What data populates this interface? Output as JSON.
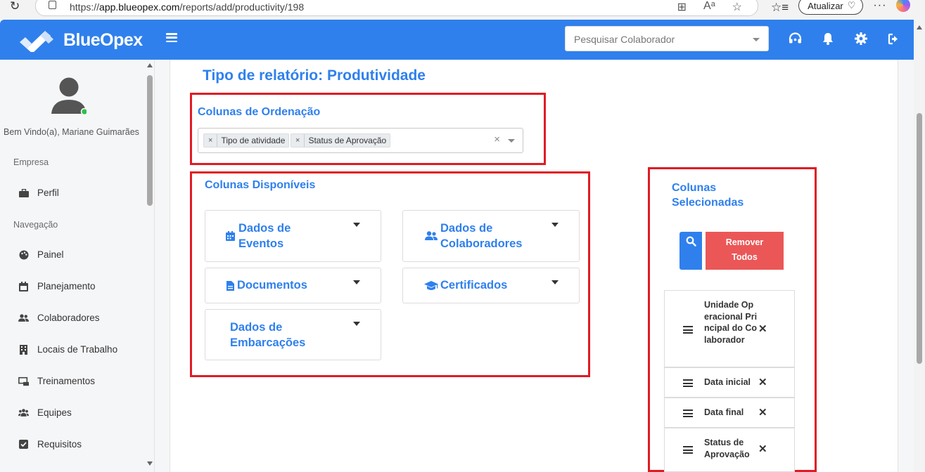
{
  "browser": {
    "url_prefix": "https://",
    "url_host": "app.blueopex.com",
    "url_path": "/reports/add/productivity/198",
    "update_label": "Atualizar",
    "menu_dots": "···"
  },
  "header": {
    "brand": "BlueOpex",
    "search_placeholder": "Pesquisar Colaborador"
  },
  "sidebar": {
    "greeting": "Bem Vindo(a), Mariane Guimarães",
    "section_company": "Empresa",
    "section_nav": "Navegação",
    "items": [
      {
        "label": "Perfil",
        "icon": "briefcase-icon"
      },
      {
        "label": "Painel",
        "icon": "palette-icon"
      },
      {
        "label": "Planejamento",
        "icon": "calendar-icon"
      },
      {
        "label": "Colaboradores",
        "icon": "users-icon"
      },
      {
        "label": "Locais de Trabalho",
        "icon": "building-icon"
      },
      {
        "label": "Treinamentos",
        "icon": "chalkboard-icon"
      },
      {
        "label": "Equipes",
        "icon": "team-icon"
      },
      {
        "label": "Requisitos",
        "icon": "checkbox-icon"
      }
    ]
  },
  "main": {
    "title": "Tipo de relatório: Produtividade",
    "ordering": {
      "title": "Colunas de Ordenação",
      "chips": [
        "Tipo de atividade",
        "Status de Aprovação"
      ],
      "chip_remove": "×",
      "clear": "×"
    },
    "available": {
      "title": "Colunas Disponíveis",
      "categories": [
        {
          "label": "Dados de Eventos",
          "icon": "calendar-icon"
        },
        {
          "label": "Dados de Colaboradores",
          "icon": "users-icon"
        },
        {
          "label": "Documentos",
          "icon": "file-icon"
        },
        {
          "label": "Certificados",
          "icon": "graduation-cap-icon"
        },
        {
          "label": "Dados de Embarcações",
          "icon": ""
        }
      ]
    },
    "selected": {
      "title": "Colunas Selecionadas",
      "remove_all": "Remover Todos",
      "remove_symbol": "✕",
      "items": [
        "Unidade Operacional Principal do Colaborador",
        "Data inicial",
        "Data final",
        "Status de Aprovação"
      ]
    }
  },
  "colors": {
    "primary": "#2f80ed",
    "danger": "#eb5757",
    "highlight_box": "#e01b24"
  }
}
